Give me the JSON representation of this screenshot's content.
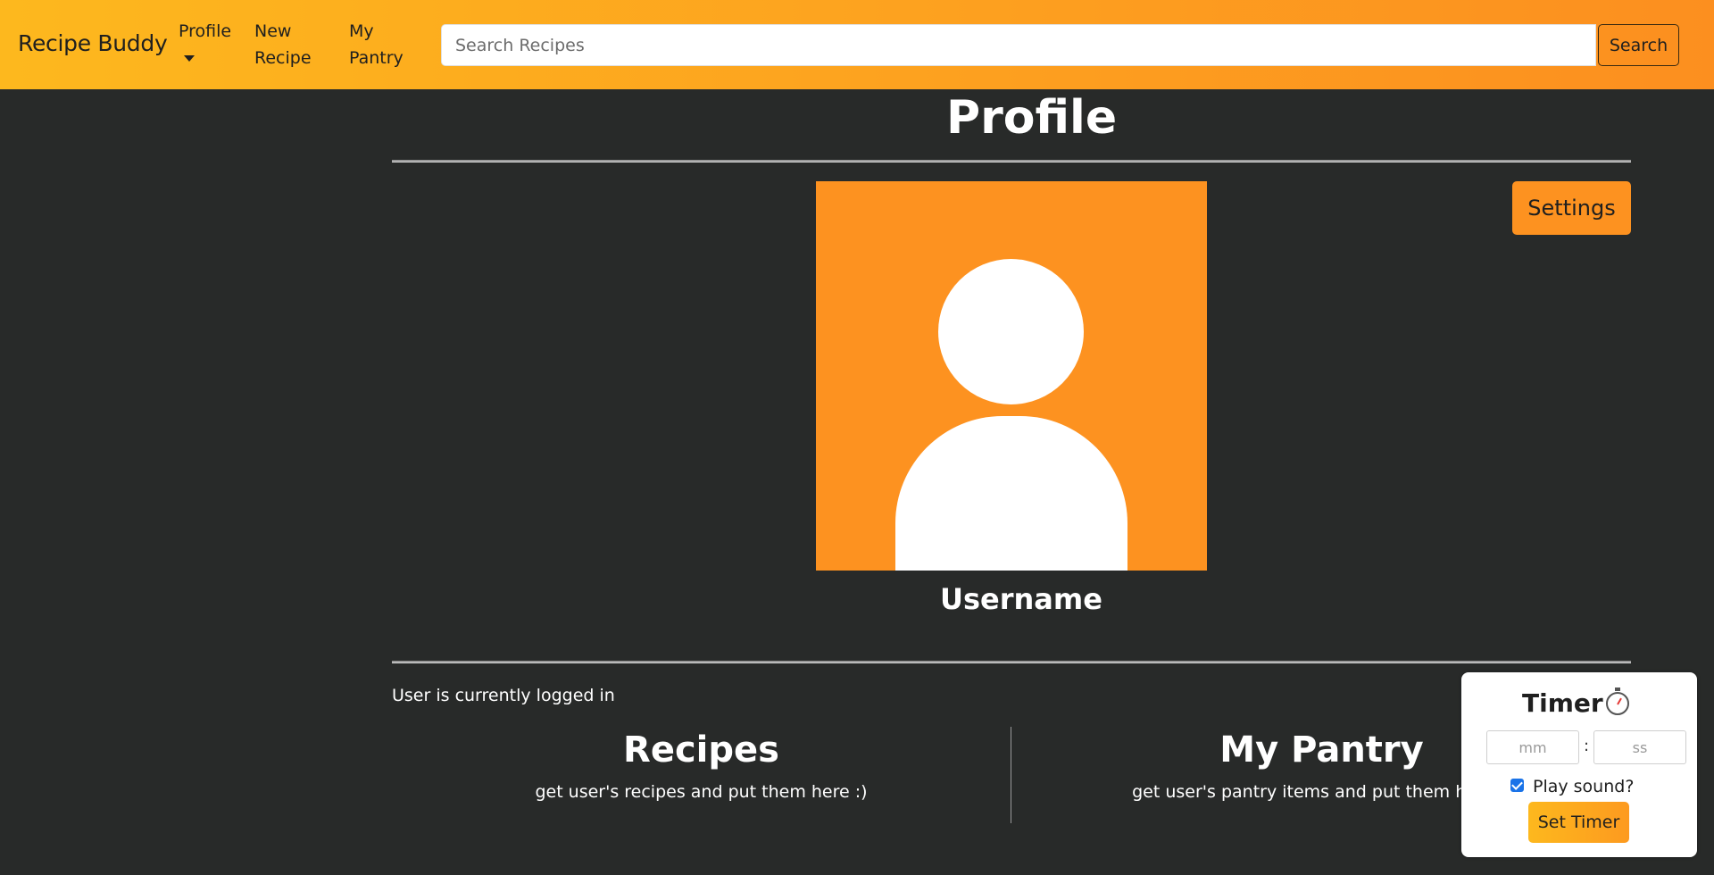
{
  "navbar": {
    "brand": "Recipe Buddy",
    "items": [
      {
        "label": "Profile"
      },
      {
        "label": "New Recipe"
      },
      {
        "label": "My Pantry"
      }
    ],
    "search": {
      "placeholder": "Search Recipes",
      "value": "",
      "button_label": "Search"
    }
  },
  "profile": {
    "title": "Profile",
    "settings_label": "Settings",
    "username": "Username",
    "avatar_icon": "user-silhouette-icon",
    "status_text": "User is currently logged in"
  },
  "sections": {
    "recipes": {
      "title": "Recipes",
      "body": "get user's recipes and put them here :)"
    },
    "pantry": {
      "title": "My Pantry",
      "body": "get user's pantry items and put them here :)"
    }
  },
  "timer": {
    "title": "Timer",
    "icon": "stopwatch-icon",
    "minutes_placeholder": "mm",
    "seconds_placeholder": "ss",
    "separator": ":",
    "play_sound_label": "Play sound?",
    "play_sound_checked": true,
    "button_label": "Set Timer"
  },
  "colors": {
    "accent": "#fd9220",
    "nav_gradient_start": "#fdb81e",
    "background": "#282a29"
  }
}
